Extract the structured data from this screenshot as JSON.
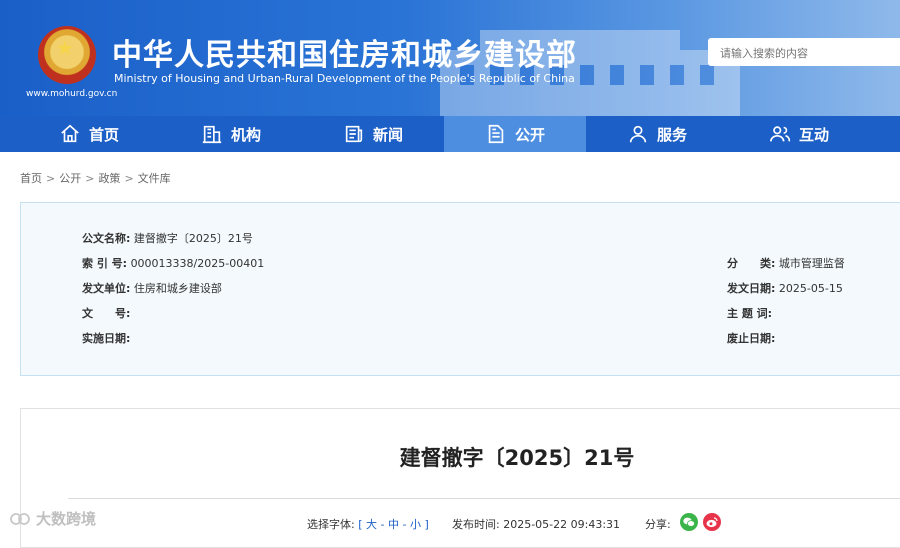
{
  "header": {
    "title_cn": "中华人民共和国住房和城乡建设部",
    "title_en": "Ministry of Housing and Urban-Rural Development of the People's Republic of China",
    "site_url": "www.mohurd.gov.cn",
    "search_placeholder": "请输入搜索的内容"
  },
  "nav": {
    "items": [
      {
        "label": "首页",
        "icon": "home-icon"
      },
      {
        "label": "机构",
        "icon": "building-icon"
      },
      {
        "label": "新闻",
        "icon": "newspaper-icon"
      },
      {
        "label": "公开",
        "icon": "document-icon",
        "active": true
      },
      {
        "label": "服务",
        "icon": "service-user-icon"
      },
      {
        "label": "互动",
        "icon": "interact-users-icon"
      }
    ]
  },
  "breadcrumb": [
    "首页",
    "公开",
    "政策",
    "文件库"
  ],
  "info": {
    "name_label": "公文名称:",
    "name_value": "建督撤字〔2025〕21号",
    "index_label": "索 引 号:",
    "index_value": "000013338/2025-00401",
    "category_label": "分　　类:",
    "category_value": "城市管理监督",
    "issuer_label": "发文单位:",
    "issuer_value": "住房和城乡建设部",
    "issue_date_label": "发文日期:",
    "issue_date_value": "2025-05-15",
    "doc_no_label": "文　　号:",
    "doc_no_value": "",
    "subject_label": "主 题 词:",
    "subject_value": "",
    "effective_label": "实施日期:",
    "effective_value": "",
    "expire_label": "废止日期:",
    "expire_value": ""
  },
  "document": {
    "title": "建督撤字〔2025〕21号",
    "font_size_label": "选择字体:",
    "font_large": "大",
    "font_medium": "中",
    "font_small": "小",
    "publish_label": "发布时间:",
    "publish_time": "2025-05-22 09:43:31",
    "share_label": "分享:"
  },
  "watermark": "大数跨境",
  "colors": {
    "nav_bg": "#1c5fc7",
    "nav_active": "#4d8ee0",
    "info_bg": "#f3f9fd",
    "link": "#1c5fc7"
  }
}
